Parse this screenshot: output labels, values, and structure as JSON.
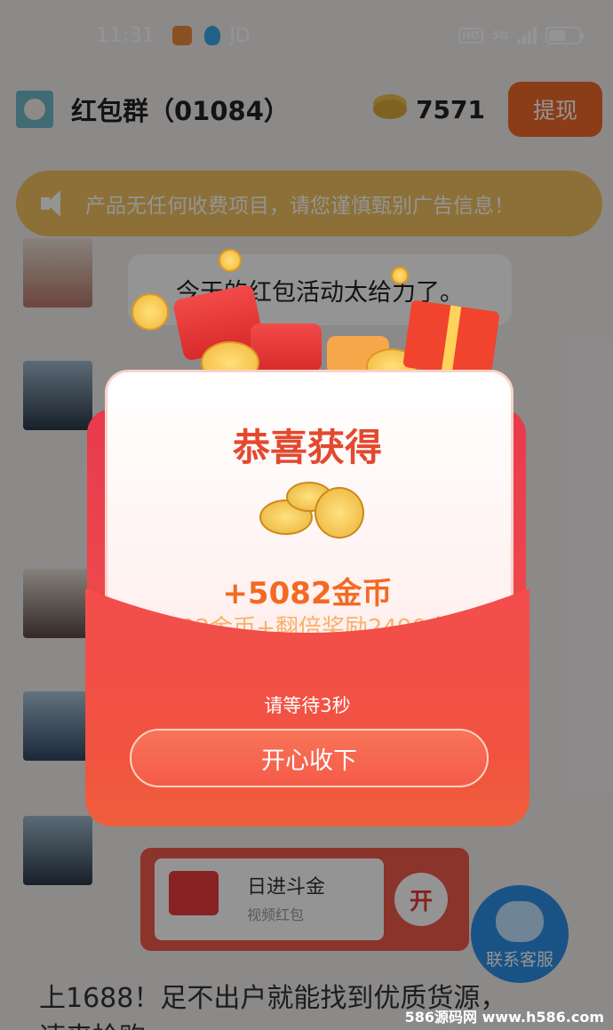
{
  "status_bar": {
    "time": "11:31",
    "carrier": "JD",
    "hd": "HD",
    "network": "5G"
  },
  "header": {
    "title": "红包群（01084）",
    "coins": "7571",
    "withdraw_label": "提现"
  },
  "notice": {
    "text": "产品无任何收费项目，请您谨慎甄别广告信息！"
  },
  "chat": {
    "message": "今天的红包活动太给力了。",
    "video_card": {
      "title": "日进斗金",
      "subtitle": "视频红包",
      "open_label": "开"
    },
    "support_label": "联系客服",
    "bottom_text_line1": "上1688！足不出户就能找到优质货源，",
    "bottom_text_line2": "速来抢购"
  },
  "reward_modal": {
    "title": "恭喜获得",
    "amount": "+5082金币",
    "detail": "2592金币+翻倍奖励2490金币",
    "countdown": "请等待3秒",
    "accept_label": "开心收下"
  },
  "watermark": "586源码网 www.h586.com",
  "colors": {
    "accent": "#f06a2a",
    "envelope_red": "#ef3e4b",
    "gold": "#f2b53a",
    "notice": "#f1c15f"
  }
}
